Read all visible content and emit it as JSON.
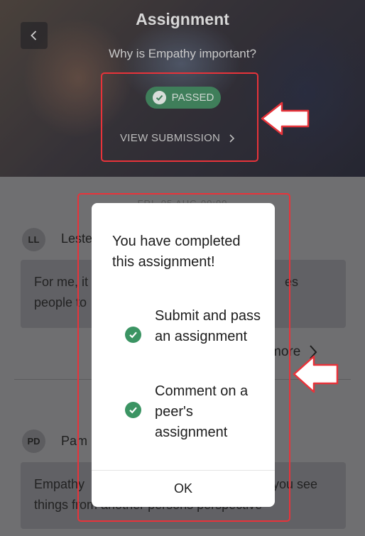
{
  "header": {
    "title": "Assignment",
    "question": "Why is Empathy important?",
    "status_badge": "PASSED",
    "view_submission": "VIEW SUBMISSION"
  },
  "feed": {
    "date": "FRI, 05 AUG 00:00",
    "comments": [
      {
        "initials": "LL",
        "author": "Leste",
        "text_visible_left": "For me, it",
        "text_visible_right": "es",
        "text_line2": "people to"
      },
      {
        "initials": "PD",
        "author": "Pam",
        "text_visible_left": "Empathy",
        "text_visible_right": "you see",
        "text_line2": "things from another persons perspective"
      }
    ],
    "more_label": "more"
  },
  "modal": {
    "title": "You have completed this assignment!",
    "items": [
      {
        "label": "Submit and pass an assignment"
      },
      {
        "label": "Comment on a peer's assignment"
      }
    ],
    "ok_label": "OK"
  },
  "colors": {
    "accent_green": "#3b9463",
    "badge_green": "#3f7e5a",
    "annotation_red": "#e8333a"
  }
}
